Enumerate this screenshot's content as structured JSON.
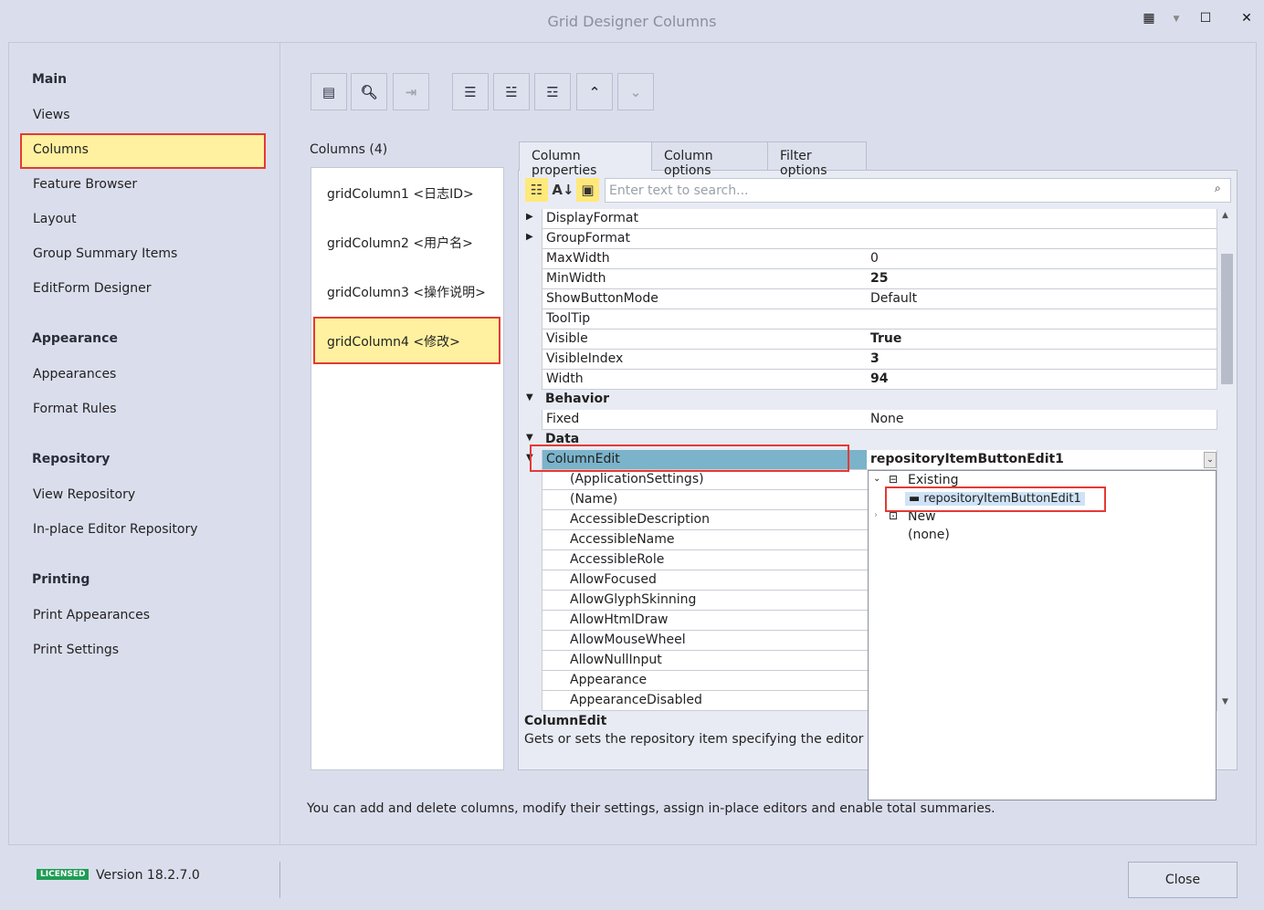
{
  "window": {
    "title": "Grid Designer Columns",
    "controls": [
      "palette-icon",
      "dropdown-icon",
      "maximize-icon",
      "close-icon"
    ]
  },
  "nav": {
    "groups": [
      {
        "heading": "Main",
        "items": [
          "Views",
          "Columns",
          "Feature Browser",
          "Layout",
          "Group Summary Items",
          "EditForm Designer"
        ]
      },
      {
        "heading": "Appearance",
        "items": [
          "Appearances",
          "Format Rules"
        ]
      },
      {
        "heading": "Repository",
        "items": [
          "View Repository",
          "In-place Editor Repository"
        ]
      },
      {
        "heading": "Printing",
        "items": [
          "Print Appearances",
          "Print Settings"
        ]
      }
    ],
    "selected": "Columns"
  },
  "columns": {
    "label": "Columns (4)",
    "items": [
      "gridColumn1 <日志ID>",
      "gridColumn2 <用户名>",
      "gridColumn3 <操作说明>",
      "gridColumn4 <修改>"
    ],
    "selected_index": 3
  },
  "tabs": [
    "Column properties",
    "Column options",
    "Filter options"
  ],
  "search": {
    "placeholder": "Enter text to search..."
  },
  "properties": [
    {
      "name": "DisplayFormat",
      "value": "",
      "expand": "collapsed"
    },
    {
      "name": "GroupFormat",
      "value": "",
      "expand": "collapsed"
    },
    {
      "name": "MaxWidth",
      "value": "0"
    },
    {
      "name": "MinWidth",
      "value": "25",
      "bold": true
    },
    {
      "name": "ShowButtonMode",
      "value": "Default"
    },
    {
      "name": "ToolTip",
      "value": ""
    },
    {
      "name": "Visible",
      "value": "True",
      "bold": true
    },
    {
      "name": "VisibleIndex",
      "value": "3",
      "bold": true
    },
    {
      "name": "Width",
      "value": "94",
      "bold": true
    },
    {
      "name": "Behavior",
      "category": true
    },
    {
      "name": "Fixed",
      "value": "None"
    },
    {
      "name": "Data",
      "category": true
    },
    {
      "name": "ColumnEdit",
      "value": "repositoryItemButtonEdit1",
      "bold": true,
      "selected": true,
      "expand": "expanded"
    },
    {
      "name": "(ApplicationSettings)",
      "sub": true,
      "expand": "collapsed"
    },
    {
      "name": "(Name)",
      "sub": true
    },
    {
      "name": "AccessibleDescription",
      "sub": true
    },
    {
      "name": "AccessibleName",
      "sub": true
    },
    {
      "name": "AccessibleRole",
      "sub": true
    },
    {
      "name": "AllowFocused",
      "sub": true
    },
    {
      "name": "AllowGlyphSkinning",
      "sub": true
    },
    {
      "name": "AllowHtmlDraw",
      "sub": true
    },
    {
      "name": "AllowMouseWheel",
      "sub": true
    },
    {
      "name": "AllowNullInput",
      "sub": true
    },
    {
      "name": "Appearance",
      "sub": true,
      "expand": "collapsed"
    },
    {
      "name": "AppearanceDisabled",
      "sub": true,
      "expand": "collapsed"
    }
  ],
  "description": {
    "title": "ColumnEdit",
    "text": "Gets or sets the repository item specifying the editor used"
  },
  "popup": {
    "existing": "Existing",
    "item": "repositoryItemButtonEdit1",
    "new": "New",
    "none": "(none)"
  },
  "hint": "You can add and delete columns, modify their settings, assign in-place editors and enable total summaries.",
  "footer": {
    "badge": "LICENSED",
    "version": "Version 18.2.7.0",
    "close": "Close"
  }
}
